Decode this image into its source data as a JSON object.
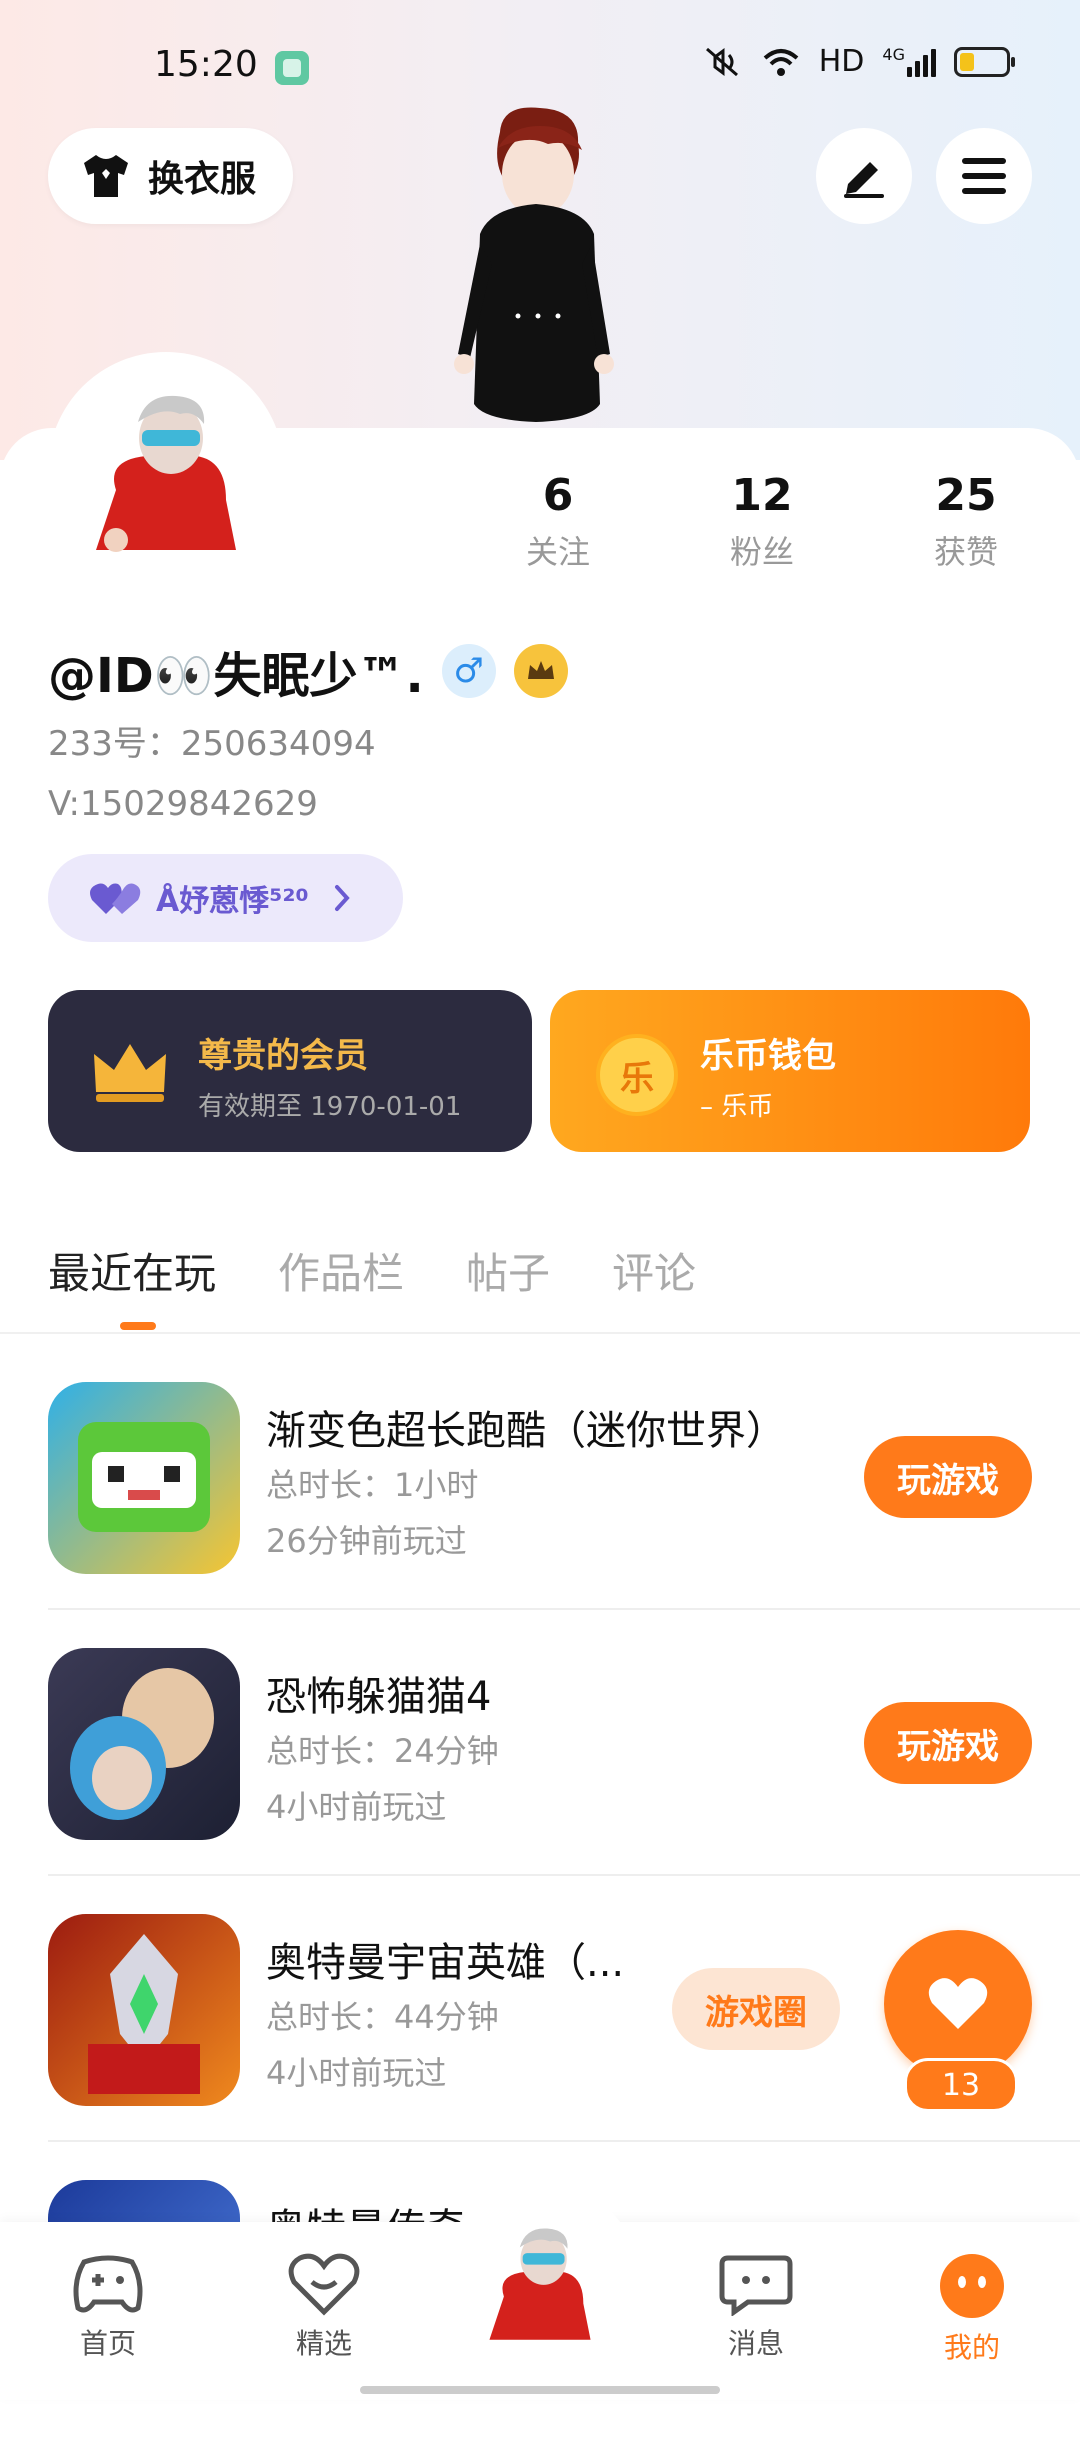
{
  "status_bar": {
    "time": "15:20",
    "network": "HD",
    "signal_label": "4G"
  },
  "header": {
    "outfit_label": "换衣服"
  },
  "profile": {
    "stats": [
      {
        "num": "6",
        "label": "关注"
      },
      {
        "num": "12",
        "label": "粉丝"
      },
      {
        "num": "25",
        "label": "获赞"
      }
    ],
    "nickname": "@ID👀失眠少™.",
    "gender_symbol": "♂",
    "id_line": "233号：250634094",
    "v_line": "V:15029842629",
    "pill_label": "Å妤蒽悸⁵²⁰"
  },
  "cards": {
    "vip": {
      "title": "尊贵的会员",
      "sub": "有效期至 1970-01-01"
    },
    "wallet": {
      "title": "乐币钱包",
      "sub": "– 乐币",
      "coin_glyph": "乐"
    }
  },
  "tabs": [
    "最近在玩",
    "作品栏",
    "帖子",
    "评论"
  ],
  "games": [
    {
      "title": "渐变色超长跑酷（迷你世界）",
      "dur": "总时长：1小时",
      "ago": "26分钟前玩过",
      "action": "玩游戏"
    },
    {
      "title": "恐怖躲猫猫4",
      "dur": "总时长：24分钟",
      "ago": "4小时前玩过",
      "action": "玩游戏"
    },
    {
      "title": "奥特曼宇宙英雄（...",
      "dur": "总时长：44分钟",
      "ago": "4小时前玩过",
      "action": "游戏圈"
    },
    {
      "title": "奥特曼传奇"
    }
  ],
  "floating_like": {
    "count": "13"
  },
  "bottom_nav": [
    {
      "label": "首页"
    },
    {
      "label": "精选"
    },
    {
      "label": "消息"
    },
    {
      "label": "我的"
    }
  ],
  "colors": {
    "accent": "#ff7a1a",
    "vip_bg": "#2c2b3f",
    "pill_bg": "#ece9fb"
  }
}
